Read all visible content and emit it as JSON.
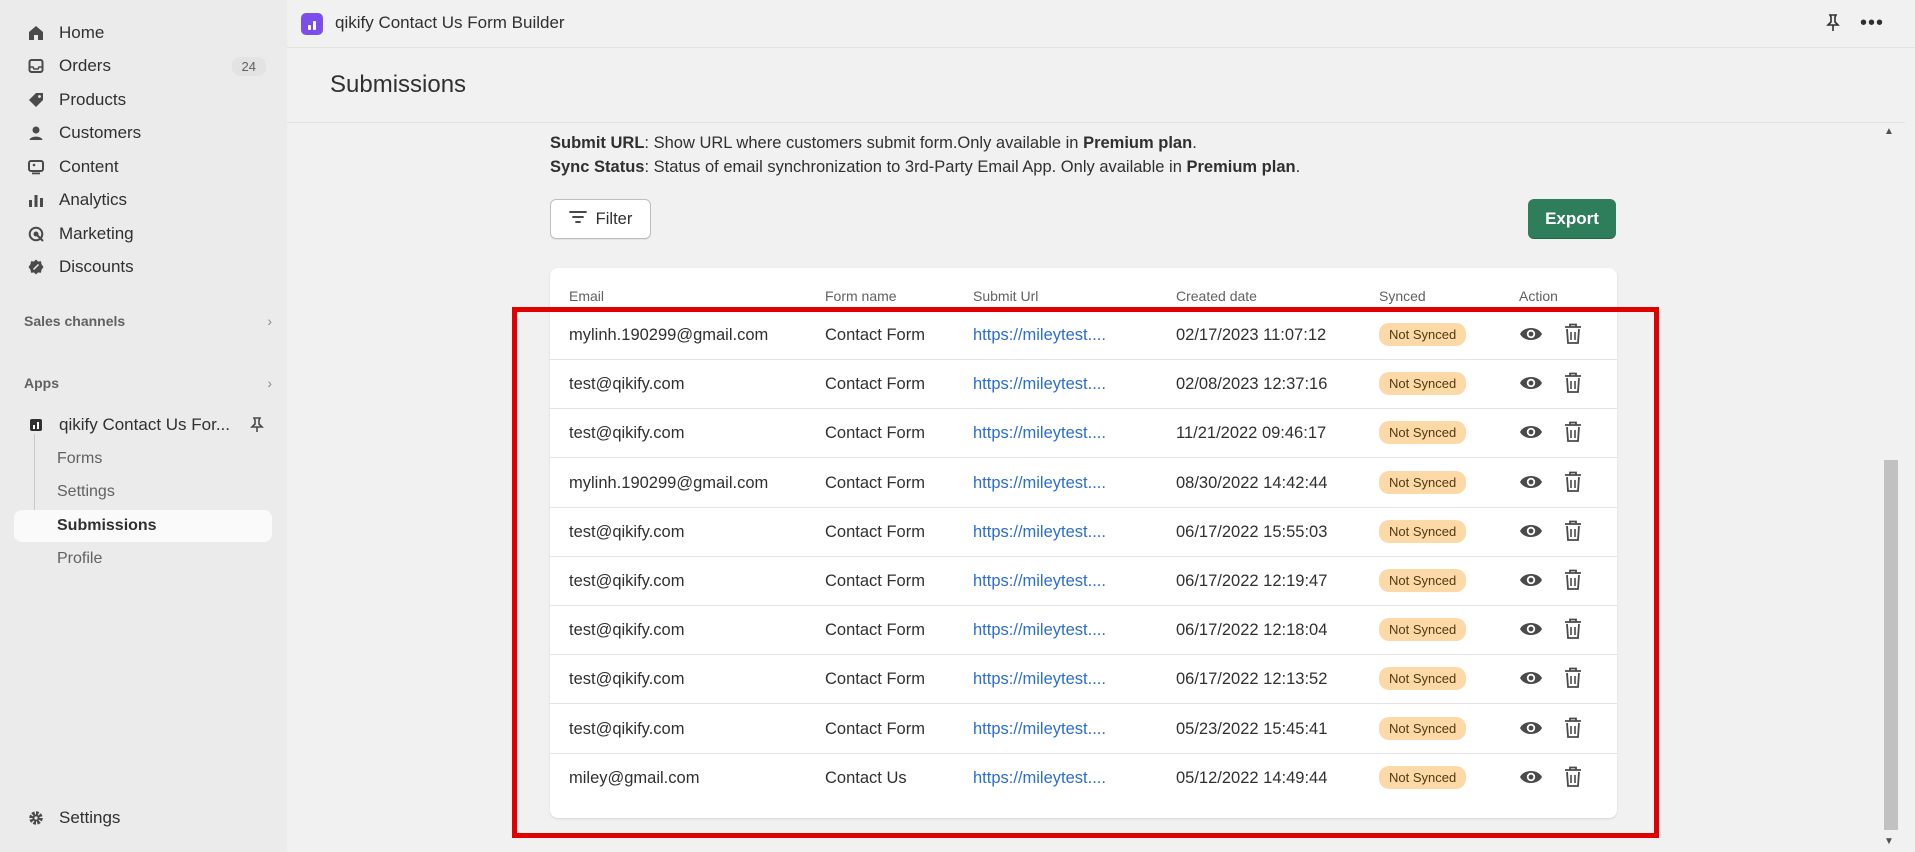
{
  "sidebar": {
    "nav": [
      {
        "label": "Home",
        "icon": "home-icon"
      },
      {
        "label": "Orders",
        "icon": "orders-icon",
        "badge": "24"
      },
      {
        "label": "Products",
        "icon": "tag-icon"
      },
      {
        "label": "Customers",
        "icon": "person-icon"
      },
      {
        "label": "Content",
        "icon": "content-icon"
      },
      {
        "label": "Analytics",
        "icon": "analytics-icon"
      },
      {
        "label": "Marketing",
        "icon": "marketing-icon"
      },
      {
        "label": "Discounts",
        "icon": "discount-icon"
      }
    ],
    "sales_channels": "Sales channels",
    "apps": "Apps",
    "app_name": "qikify Contact Us For...",
    "app_sub": [
      "Forms",
      "Settings",
      "Submissions",
      "Profile"
    ],
    "settings": "Settings"
  },
  "topbar": {
    "app_title": "qikify Contact Us Form Builder"
  },
  "page": {
    "title": "Submissions",
    "info1_label": "Submit URL",
    "info1_text": ": Show URL where customers submit form.Only available in ",
    "info1_plan": "Premium plan",
    "info2_label": "Sync Status",
    "info2_text": ": Status of email synchronization to 3rd-Party Email App. Only available in ",
    "info2_plan": "Premium plan",
    "period": ".",
    "filter_label": "Filter",
    "export_label": "Export"
  },
  "table": {
    "headers": [
      "Email",
      "Form name",
      "Submit Url",
      "Created date",
      "Synced",
      "Action"
    ],
    "rows": [
      {
        "email": "mylinh.190299@gmail.com",
        "form": "Contact Form",
        "url": "https://mileytest....",
        "date": "02/17/2023 11:07:12",
        "status": "Not Synced"
      },
      {
        "email": "test@qikify.com",
        "form": "Contact Form",
        "url": "https://mileytest....",
        "date": "02/08/2023 12:37:16",
        "status": "Not Synced"
      },
      {
        "email": "test@qikify.com",
        "form": "Contact Form",
        "url": "https://mileytest....",
        "date": "11/21/2022 09:46:17",
        "status": "Not Synced"
      },
      {
        "email": "mylinh.190299@gmail.com",
        "form": "Contact Form",
        "url": "https://mileytest....",
        "date": "08/30/2022 14:42:44",
        "status": "Not Synced"
      },
      {
        "email": "test@qikify.com",
        "form": "Contact Form",
        "url": "https://mileytest....",
        "date": "06/17/2022 15:55:03",
        "status": "Not Synced"
      },
      {
        "email": "test@qikify.com",
        "form": "Contact Form",
        "url": "https://mileytest....",
        "date": "06/17/2022 12:19:47",
        "status": "Not Synced"
      },
      {
        "email": "test@qikify.com",
        "form": "Contact Form",
        "url": "https://mileytest....",
        "date": "06/17/2022 12:18:04",
        "status": "Not Synced"
      },
      {
        "email": "test@qikify.com",
        "form": "Contact Form",
        "url": "https://mileytest....",
        "date": "06/17/2022 12:13:52",
        "status": "Not Synced"
      },
      {
        "email": "test@qikify.com",
        "form": "Contact Form",
        "url": "https://mileytest....",
        "date": "05/23/2022 15:45:41",
        "status": "Not Synced"
      },
      {
        "email": "miley@gmail.com",
        "form": "Contact Us",
        "url": "https://mileytest....",
        "date": "05/12/2022 14:49:44",
        "status": "Not Synced"
      }
    ]
  },
  "colors": {
    "accent_purple": "#7b4dea",
    "export_green": "#2e7d5b",
    "link_blue": "#2c6ecb",
    "status_bg": "#fcd9a7",
    "highlight_red": "#e00000"
  }
}
